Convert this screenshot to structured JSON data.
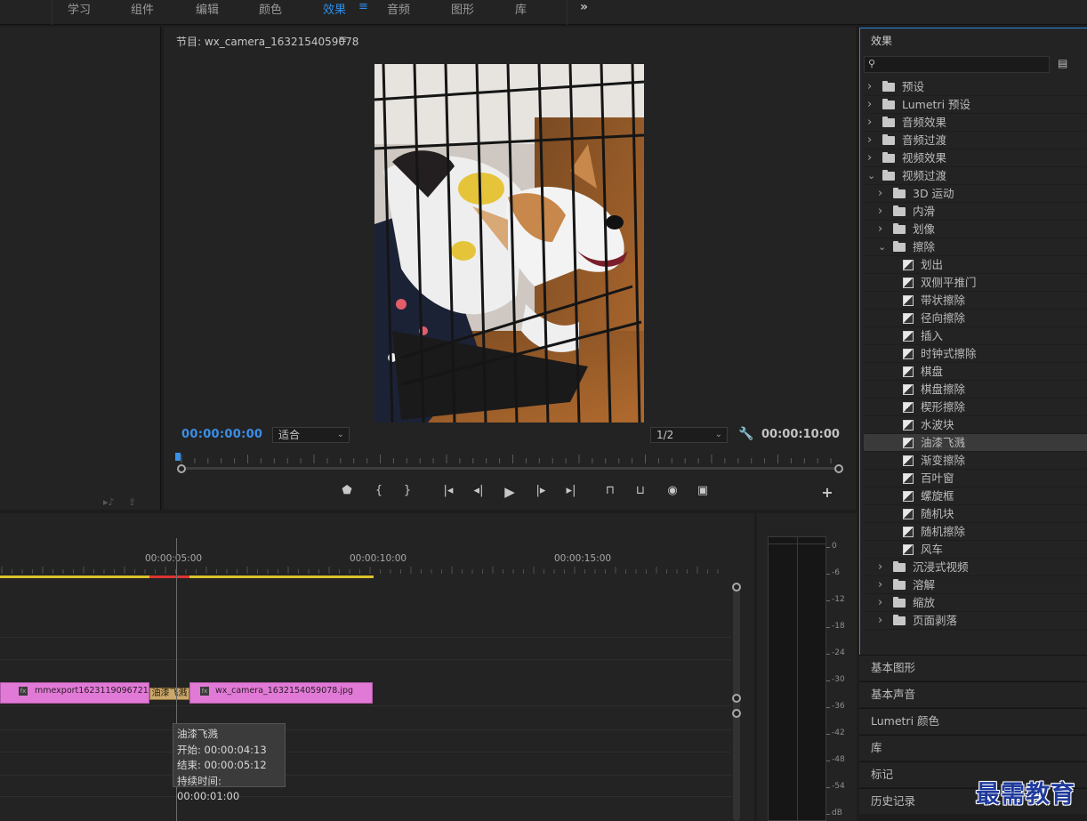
{
  "workspace": {
    "tabs": [
      {
        "label": "学习"
      },
      {
        "label": "组件"
      },
      {
        "label": "编辑"
      },
      {
        "label": "颜色"
      },
      {
        "label": "效果",
        "active": true
      },
      {
        "label": "音频"
      },
      {
        "label": "图形"
      },
      {
        "label": "库"
      }
    ],
    "menu_icon": "hamburger-icon",
    "more_icon": "chevron-double-right-icon",
    "more_glyph": "»"
  },
  "monitor": {
    "title": "节目: wx_camera_1632154059078",
    "menu_glyph": "≡",
    "timecode_current": "00:00:00:00",
    "timecode_duration": "00:00:10:00",
    "zoom_select": "适合",
    "resolution_select": "1/2",
    "transport_icons": [
      "add-marker-icon",
      "mark-in-icon",
      "mark-out-icon",
      "go-to-in-icon",
      "step-back-icon",
      "play-icon",
      "step-forward-icon",
      "go-to-out-icon",
      "lift-icon",
      "extract-icon",
      "export-frame-icon",
      "comparison-view-icon",
      "add-button-icon"
    ]
  },
  "effects": {
    "title": "效果",
    "search_placeholder": "",
    "items": [
      {
        "label": "预设",
        "type": "folder",
        "level": 0,
        "expanded": false
      },
      {
        "label": "Lumetri 预设",
        "type": "folder",
        "level": 0,
        "expanded": false
      },
      {
        "label": "音频效果",
        "type": "folder",
        "level": 0,
        "expanded": false
      },
      {
        "label": "音频过渡",
        "type": "folder",
        "level": 0,
        "expanded": false
      },
      {
        "label": "视频效果",
        "type": "folder",
        "level": 0,
        "expanded": false
      },
      {
        "label": "视频过渡",
        "type": "folder",
        "level": 0,
        "expanded": true
      },
      {
        "label": "3D 运动",
        "type": "folder",
        "level": 1,
        "expanded": false
      },
      {
        "label": "内滑",
        "type": "folder",
        "level": 1,
        "expanded": false
      },
      {
        "label": "划像",
        "type": "folder",
        "level": 1,
        "expanded": false
      },
      {
        "label": "擦除",
        "type": "folder",
        "level": 1,
        "expanded": true
      },
      {
        "label": "划出",
        "type": "effect",
        "level": 2
      },
      {
        "label": "双侧平推门",
        "type": "effect",
        "level": 2
      },
      {
        "label": "带状擦除",
        "type": "effect",
        "level": 2
      },
      {
        "label": "径向擦除",
        "type": "effect",
        "level": 2
      },
      {
        "label": "插入",
        "type": "effect",
        "level": 2
      },
      {
        "label": "时钟式擦除",
        "type": "effect",
        "level": 2
      },
      {
        "label": "棋盘",
        "type": "effect",
        "level": 2
      },
      {
        "label": "棋盘擦除",
        "type": "effect",
        "level": 2
      },
      {
        "label": "楔形擦除",
        "type": "effect",
        "level": 2
      },
      {
        "label": "水波块",
        "type": "effect",
        "level": 2
      },
      {
        "label": "油漆飞溅",
        "type": "effect",
        "level": 2,
        "selected": true
      },
      {
        "label": "渐变擦除",
        "type": "effect",
        "level": 2
      },
      {
        "label": "百叶窗",
        "type": "effect",
        "level": 2
      },
      {
        "label": "螺旋框",
        "type": "effect",
        "level": 2
      },
      {
        "label": "随机块",
        "type": "effect",
        "level": 2
      },
      {
        "label": "随机擦除",
        "type": "effect",
        "level": 2
      },
      {
        "label": "风车",
        "type": "effect",
        "level": 2
      },
      {
        "label": "沉浸式视频",
        "type": "folder",
        "level": 1,
        "expanded": false
      },
      {
        "label": "溶解",
        "type": "folder",
        "level": 1,
        "expanded": false
      },
      {
        "label": "缩放",
        "type": "folder",
        "level": 1,
        "expanded": false
      },
      {
        "label": "页面剥落",
        "type": "folder",
        "level": 1,
        "expanded": false
      }
    ]
  },
  "side_tabs": [
    {
      "label": "基本图形"
    },
    {
      "label": "基本声音"
    },
    {
      "label": "Lumetri 颜色"
    },
    {
      "label": "库"
    },
    {
      "label": "标记"
    },
    {
      "label": "历史记录"
    }
  ],
  "timeline": {
    "ruler": [
      "00:00:05:00",
      "00:00:10:00",
      "00:00:15:00"
    ],
    "clips": [
      {
        "name": "mmexport1623119096721.jpg",
        "fx": "fx"
      },
      {
        "name": "wx_camera_1632154059078.jpg",
        "fx": "fx"
      }
    ],
    "transition_label": "油漆飞溅",
    "tooltip": {
      "name": "油漆飞溅",
      "start": "开始: 00:00:04:13",
      "end": "结束: 00:00:05:12",
      "duration": "持续时间: 00:00:01:00"
    }
  },
  "meter": {
    "db_labels": [
      "0",
      "-6",
      "-12",
      "-18",
      "-24",
      "-30",
      "-36",
      "-42",
      "-48",
      "-54",
      "dB"
    ]
  },
  "watermark": "最需教育",
  "colors": {
    "accent": "#2d8ceb",
    "clip": "#e17ad6",
    "workarea": "#d9c32a",
    "transition": "#c9a86b"
  }
}
